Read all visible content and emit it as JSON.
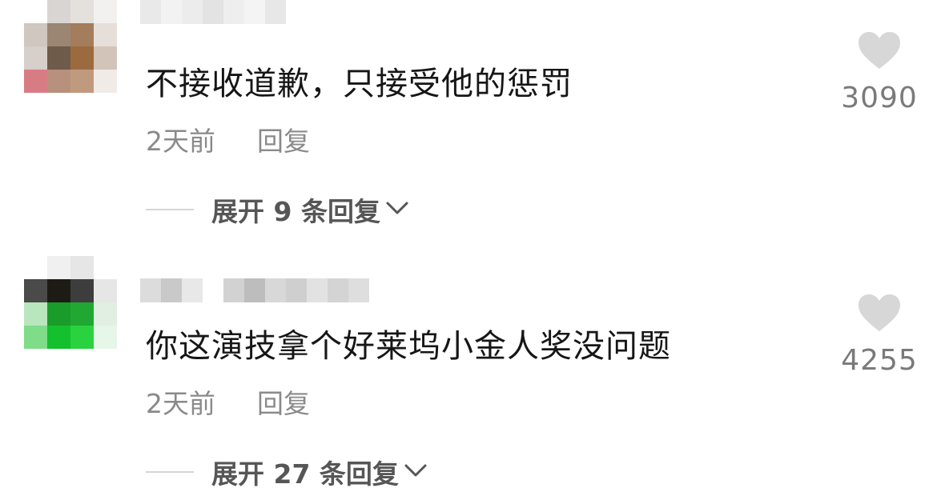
{
  "comments": [
    {
      "text": "不接收道歉，只接受他的惩罚",
      "time": "2天前",
      "reply_label": "回复",
      "expand_label": "展开 9 条回复",
      "like_count": "3090",
      "avatar_colors": [
        "#ffffff",
        "#d9d5d2",
        "#e4e0dc",
        "#f3f1ef",
        "#cfc7c0",
        "#9b8674",
        "#a47d5c",
        "#e6dfd9",
        "#d6cfca",
        "#6f5b4a",
        "#9c6a3f",
        "#d2c4b8",
        "#d87c84",
        "#b7917b",
        "#c09a7f",
        "#f0ebe7"
      ]
    },
    {
      "text": "你这演技拿个好莱坞小金人奖没问题",
      "time": "2天前",
      "reply_label": "回复",
      "expand_label": "展开 27 条回复",
      "like_count": "4255",
      "avatar_colors": [
        "#ffffff",
        "#f0f0f0",
        "#e6e6e6",
        "#ffffff",
        "#4a4a4a",
        "#1c1c14",
        "#3d3d3d",
        "#e6e6e6",
        "#b9e6bd",
        "#199c2a",
        "#20a833",
        "#e0efe1",
        "#7fdc89",
        "#14c02d",
        "#2bd23f",
        "#e6f6e8"
      ]
    }
  ],
  "colors": {
    "text": "#161616",
    "meta": "#8a8a8a",
    "expand": "#565656",
    "heart": "#d7d7d7"
  },
  "icons": {
    "like": "heart-icon",
    "expand": "chevron-down-icon"
  }
}
